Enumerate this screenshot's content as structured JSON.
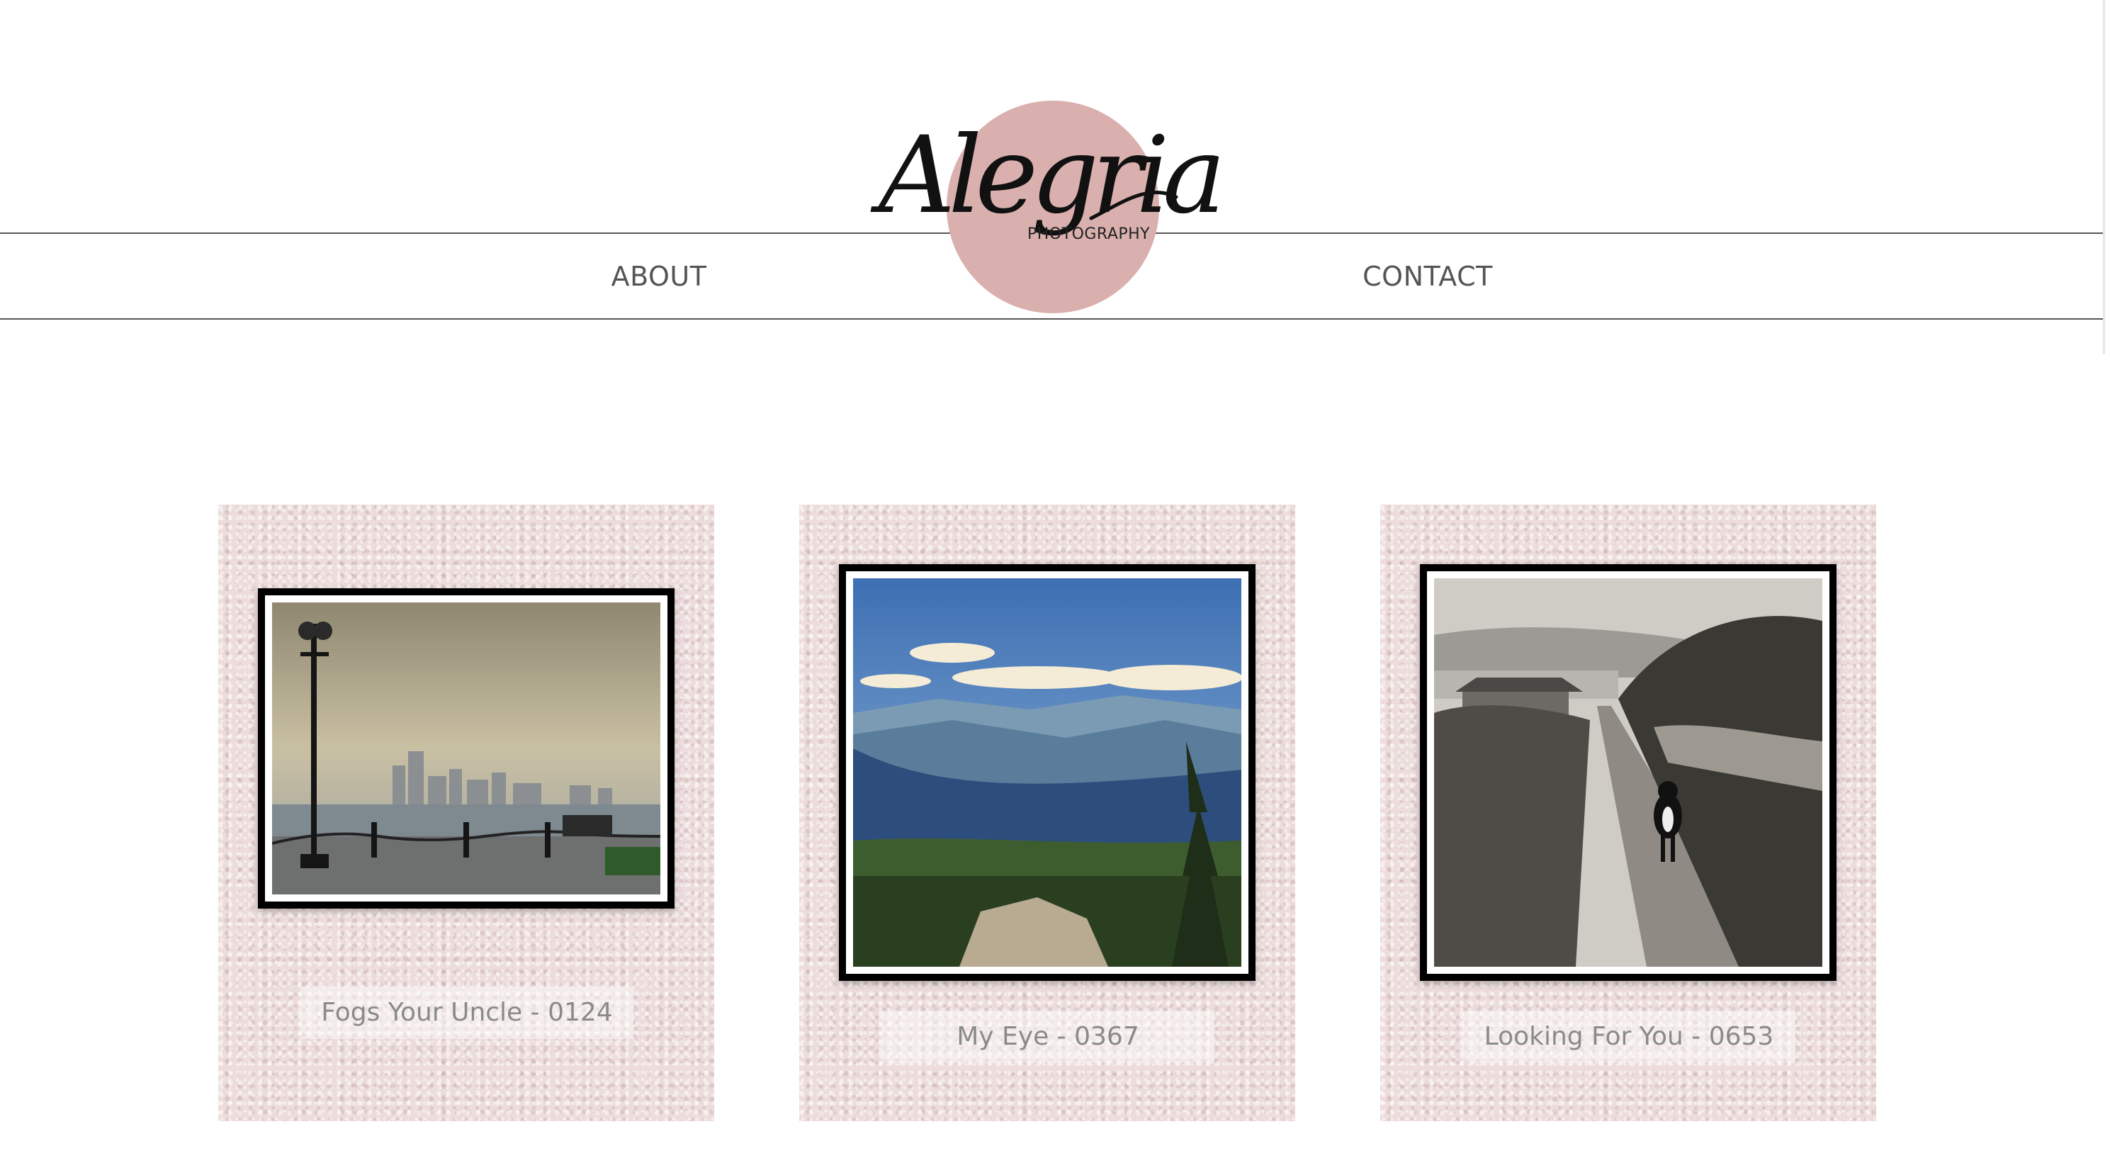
{
  "header": {
    "logo": {
      "script_text": "Alegria",
      "subtitle": "PHOTOGRAPHY",
      "circle_color": "#d9b0ad"
    },
    "nav": {
      "about": "ABOUT",
      "contact": "CONTACT"
    }
  },
  "gallery": {
    "items": [
      {
        "caption": "Fogs Your Uncle - 0124",
        "image": "foggy-harbor-skyline-photo"
      },
      {
        "caption": "My Eye - 0367",
        "image": "mountain-valley-vista-photo"
      },
      {
        "caption": "Looking For You - 0653",
        "image": "country-road-dog-photo"
      }
    ]
  },
  "colors": {
    "card_background": "#ecdcdb",
    "frame": "#000000",
    "nav_text": "#555555",
    "caption_text": "#8a8a8a"
  }
}
